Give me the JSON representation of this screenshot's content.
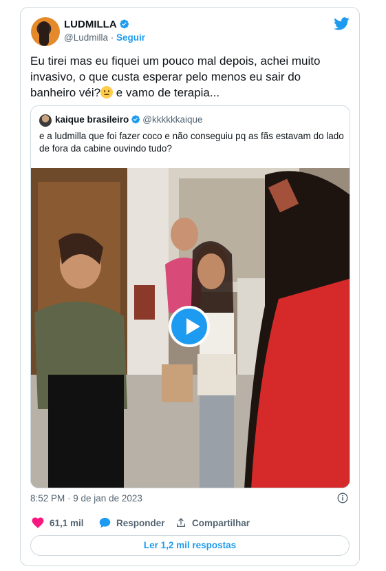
{
  "author": {
    "name": "LUDMILLA",
    "handle": "@Ludmilla",
    "separator": "·",
    "follow_label": "Seguir"
  },
  "tweet": {
    "text_before_emoji": "Eu tirei mas eu fiquei um pouco mal depois, achei muito invasivo, o que custa esperar pelo menos eu sair do banheiro véi?",
    "text_after_emoji": " e vamo de terapia...",
    "emoji": "slightly-frowning-face"
  },
  "quoted_tweet": {
    "name": "kaique brasileiro",
    "handle": "@kkkkkkaique",
    "text": "e a ludmilla que foi fazer coco e não conseguiu pq as fãs estavam do lado de fora da cabine ouvindo tudo?"
  },
  "timestamp": "8:52 PM · 9 de jan de 2023",
  "actions": {
    "likes": "61,1 mil",
    "reply_label": "Responder",
    "share_label": "Compartilhar"
  },
  "read_replies_label": "Ler 1,2 mil respostas",
  "colors": {
    "accent": "#1d9bf0",
    "like": "#f91880",
    "secondary_text": "#536471",
    "border": "#cfd9de"
  },
  "icons": [
    "verified-badge-icon",
    "twitter-bird-icon",
    "play-icon",
    "info-icon",
    "heart-icon",
    "reply-bubble-icon",
    "share-icon"
  ]
}
